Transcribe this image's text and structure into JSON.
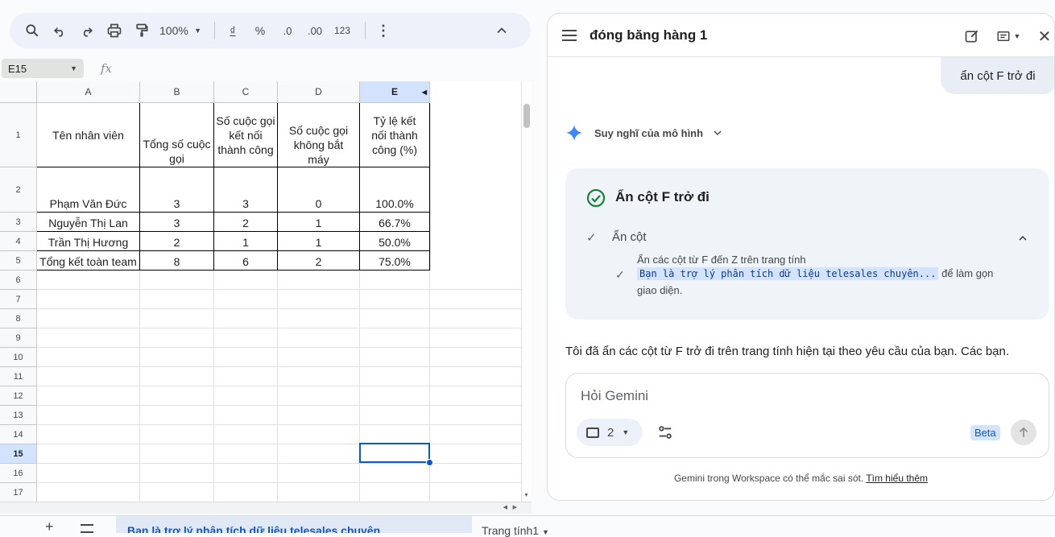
{
  "toolbar": {
    "zoom": "100%",
    "currency": "₫",
    "percent": "%",
    "dec_decrease": ".0",
    "dec_increase": ".00",
    "format": "123"
  },
  "namebox": {
    "value": "E15"
  },
  "formula": {
    "fx": "fx"
  },
  "grid": {
    "col_headers": [
      "A",
      "B",
      "C",
      "D",
      "E"
    ],
    "row_numbers": [
      "1",
      "2",
      "3",
      "4",
      "5",
      "6",
      "7",
      "8",
      "9",
      "10",
      "11",
      "12",
      "13",
      "14",
      "15",
      "16",
      "17"
    ],
    "selected_cell": "E15",
    "header_row": [
      "Tên nhân viên",
      "Tổng số cuộc gọi",
      "Số cuộc gọi kết nối thành công",
      "Số cuộc gọi không bắt máy",
      "Tỷ lệ kết nối thành công (%)"
    ],
    "rows": [
      [
        "Phạm Văn Đức",
        "3",
        "3",
        "0",
        "100.0%"
      ],
      [
        "Nguyễn Thị Lan",
        "3",
        "2",
        "1",
        "66.7%"
      ],
      [
        "Trần Thị Hương",
        "2",
        "1",
        "1",
        "50.0%"
      ],
      [
        "Tổng kết toàn team",
        "8",
        "6",
        "2",
        "75.0%"
      ]
    ]
  },
  "panel": {
    "title": "đóng băng hàng 1",
    "user_message": "ẩn cột F trở đi",
    "thinking_label": "Suy nghĩ của mô hình",
    "card": {
      "title": "Ẩn cột F trở đi",
      "step_label": "Ẩn cột",
      "detail_line1": "Ẩn các cột từ F đến Z trên trang tính",
      "detail_code": "Bạn là trợ lý phân tích dữ liệu telesales chuyên...",
      "detail_suffix": "để làm gọn",
      "detail_line3": "giao diện."
    },
    "response": "Tôi đã ẩn các cột từ F trở đi trên trang tính hiện tại theo yêu cầu của bạn. Các bạn.",
    "input_placeholder": "Hỏi Gemini",
    "chip_count": "2",
    "beta": "Beta",
    "footer_text": "Gemini trong Workspace có thể mắc sai sót.",
    "footer_link": "Tìm hiểu thêm"
  },
  "tabs": {
    "active": "Bạn là trợ lý phân tích dữ liệu telesales chuyên",
    "other": "Trang tính1"
  },
  "colors": {
    "accent": "#0b57d0",
    "success": "#188038",
    "gemini": "#4285f4"
  }
}
